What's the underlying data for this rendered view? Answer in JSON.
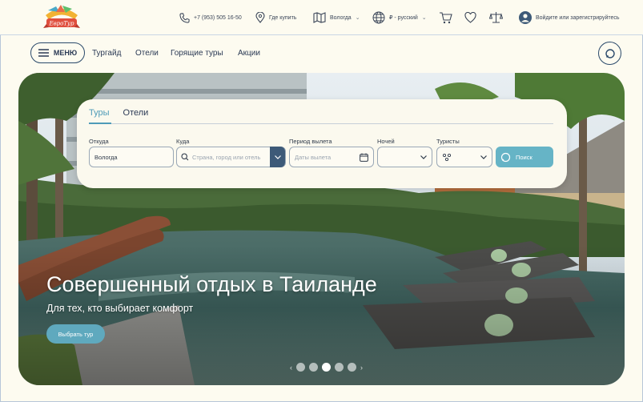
{
  "header": {
    "logo_text": "ЕвроТур",
    "phone": "+7 (953) 505 16-50",
    "where_to_buy": "Где купить",
    "city": "Вологда",
    "currency_lang": "₽ - русский",
    "login": "Войдите или зарегистрируйтесь",
    "icons": [
      "phone-icon",
      "location-icon",
      "map-icon",
      "globe-icon",
      "cart-icon",
      "heart-icon",
      "scales-icon",
      "user-icon"
    ]
  },
  "nav": {
    "menu_label": "МЕНЮ",
    "links": [
      "Тургайд",
      "Отели",
      "Горящие туры",
      "Акции"
    ]
  },
  "search": {
    "tabs": [
      "Туры",
      "Отели"
    ],
    "from_label": "Откуда",
    "from_value": "Вологда",
    "to_label": "Куда",
    "to_placeholder": "Страна, город или отель",
    "period_label": "Период вылета",
    "period_placeholder": "Даты вылета",
    "nights_label": "Ночей",
    "tourists_label": "Туристы",
    "search_button": "Поиск"
  },
  "hero": {
    "title": "Совершенный отдых в Таиланде",
    "subtitle": "Для тех, кто выбирает комфорт",
    "cta": "Выбрать тур",
    "slides_total": 5,
    "active_slide": 3
  },
  "colors": {
    "accent": "#66b4c6",
    "dark_blue": "#2b4a6b",
    "background": "#fdfbf0"
  }
}
